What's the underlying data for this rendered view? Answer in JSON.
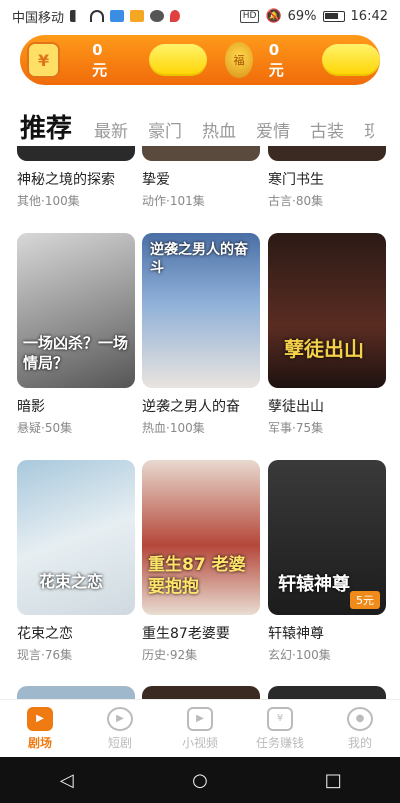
{
  "status_bar": {
    "carrier": "中国移动",
    "battery": "69%",
    "time": "16:42",
    "hd": "HD"
  },
  "banner": {
    "amount_left": "0元",
    "amount_right": "0元",
    "wallet_glyph": "¥"
  },
  "tabs": [
    {
      "label": "推荐",
      "active": true
    },
    {
      "label": "最新"
    },
    {
      "label": "豪门"
    },
    {
      "label": "热血"
    },
    {
      "label": "爱情"
    },
    {
      "label": "古装"
    },
    {
      "label": "现"
    }
  ],
  "rows": [
    [
      {
        "title": "神秘之境的探索",
        "meta": "其他·100集"
      },
      {
        "title": "挚爱",
        "meta": "动作·101集"
      },
      {
        "title": "寒门书生",
        "meta": "古言·80集"
      }
    ],
    [
      {
        "title": "暗影",
        "meta": "悬疑·50集",
        "poster_text": "一场凶杀？一场情局？"
      },
      {
        "title": "逆袭之男人的奋",
        "meta": "热血·100集",
        "poster_text": "逆袭之男人的奋斗"
      },
      {
        "title": "孽徒出山",
        "meta": "军事·75集",
        "poster_text": "孽徒出山"
      }
    ],
    [
      {
        "title": "花束之恋",
        "meta": "现言·76集",
        "poster_text": "花束之恋"
      },
      {
        "title": "重生87老婆要",
        "meta": "历史·92集",
        "poster_text": "重生87 老婆要抱抱"
      },
      {
        "title": "轩辕神尊",
        "meta": "玄幻·100集",
        "poster_text": "轩辕神尊",
        "badge": "5元"
      }
    ]
  ],
  "bottom_nav": [
    {
      "label": "剧场",
      "icon": "theater-icon",
      "active": true
    },
    {
      "label": "短剧",
      "icon": "play-circle-icon"
    },
    {
      "label": "小视频",
      "icon": "video-camera-icon"
    },
    {
      "label": "任务赚钱",
      "icon": "money-task-icon"
    },
    {
      "label": "我的",
      "icon": "user-icon"
    }
  ],
  "system_nav": {
    "back": "◁",
    "home": "○",
    "recent": "□"
  },
  "colors": {
    "accent": "#f07a12",
    "banner_start": "#ff9a1a",
    "banner_end": "#f06b0a",
    "button_yellow": "#ffd400"
  }
}
